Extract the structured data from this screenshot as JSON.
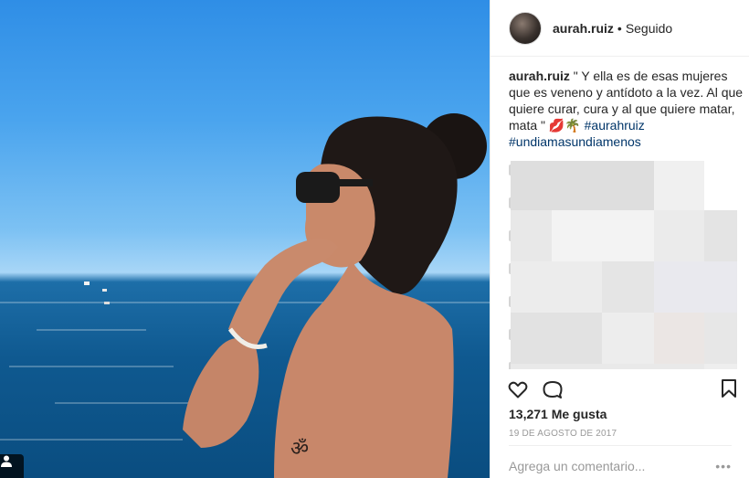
{
  "post": {
    "username": "aurah.ruiz",
    "separator": "•",
    "follow_status": "Seguido",
    "caption_username": "aurah.ruiz",
    "caption_text": " \" Y ella es de esas mujeres que es veneno y antídoto a la vez. Al que quiere curar, cura y al que quiere matar, mata \" ",
    "caption_emojis": "💋🌴",
    "hashtag_1": "#aurahruiz",
    "hashtag_2": "#undiamasundiamenos",
    "likes": "13,271 Me gusta",
    "date": "19 DE AGOSTO DE 2017",
    "comment_placeholder": "Agrega un comentario...",
    "more_options": "•••"
  },
  "icons": {
    "like": "heart-icon",
    "comment": "speech-bubble-icon",
    "save": "bookmark-icon",
    "tagged_user": "user-tag-icon"
  },
  "colors": {
    "text": "#262626",
    "hashtag": "#003569",
    "muted": "#999999",
    "border": "#efefef"
  }
}
